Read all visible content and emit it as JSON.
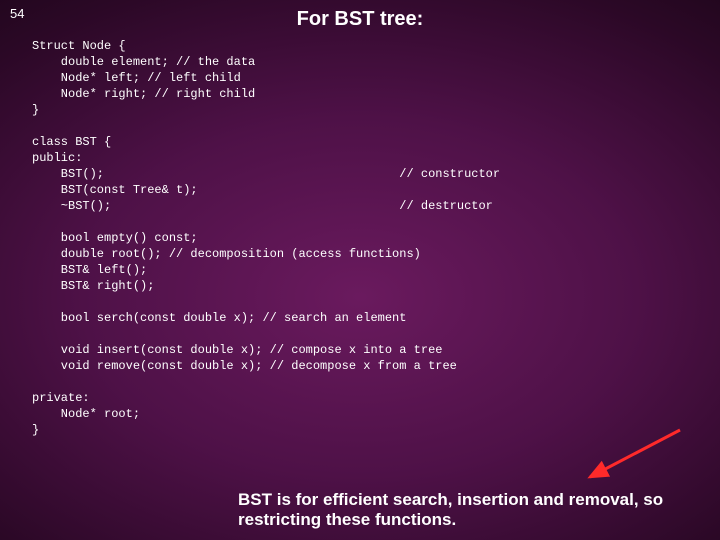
{
  "page_number": "54",
  "title": "For BST tree:",
  "code": "Struct Node {\n    double element; // the data\n    Node* left; // left child\n    Node* right; // right child\n}\n\nclass BST {\npublic:\n    BST();                                         // constructor\n    BST(const Tree& t);\n    ~BST();                                        // destructor\n\n    bool empty() const;\n    double root(); // decomposition (access functions)\n    BST& left();\n    BST& right();\n\n    bool serch(const double x); // search an element\n\n    void insert(const double x); // compose x into a tree\n    void remove(const double x); // decompose x from a tree\n\nprivate:\n    Node* root;\n}",
  "footnote": "BST is for efficient search, insertion and removal, so restricting these functions."
}
